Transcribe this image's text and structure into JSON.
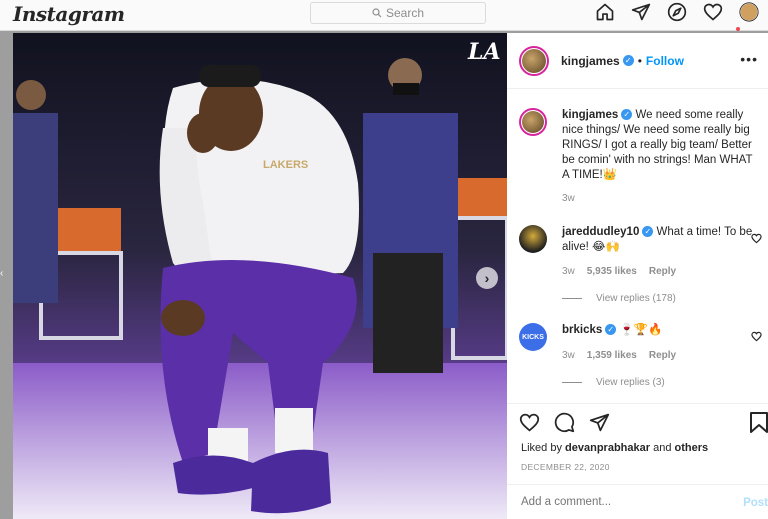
{
  "topbar": {
    "logo": "Instagram",
    "search_placeholder": "Search",
    "icons": [
      "home-icon",
      "direct-icon",
      "explore-icon",
      "activity-icon",
      "profile-icon"
    ]
  },
  "post": {
    "username": "kingjames",
    "follow_label": "Follow",
    "more_label": "•••",
    "separator": "•",
    "caption": "We need some really nice things/ We need some really big RINGS/ I got a really big team/ Better be comin' with no strings! Man WHAT A TIME!👑",
    "caption_time": "3w",
    "liked_by_prefix": "Liked by",
    "liked_by_user": "devanprabhakar",
    "liked_by_and": "and",
    "liked_by_others": "others",
    "date": "DECEMBER 22, 2020",
    "add_comment_placeholder": "Add a comment...",
    "post_label": "Post",
    "photo_logo": "LA"
  },
  "comments": [
    {
      "username": "jareddudley10",
      "text": "What a time! To be alive! 😂🙌",
      "time": "3w",
      "likes": "5,935 likes",
      "reply": "Reply",
      "view_replies": "View replies (178)"
    },
    {
      "username": "brkicks",
      "avatar_text": "KICKS",
      "text": "🍷🏆🔥",
      "time": "3w",
      "likes": "1,359 likes",
      "reply": "Reply",
      "view_replies": "View replies (3)"
    }
  ],
  "colors": {
    "verified": "#3897f0",
    "link": "#0095f6",
    "story_ring": "#d6249f",
    "post_disabled": "#b2dffc"
  }
}
